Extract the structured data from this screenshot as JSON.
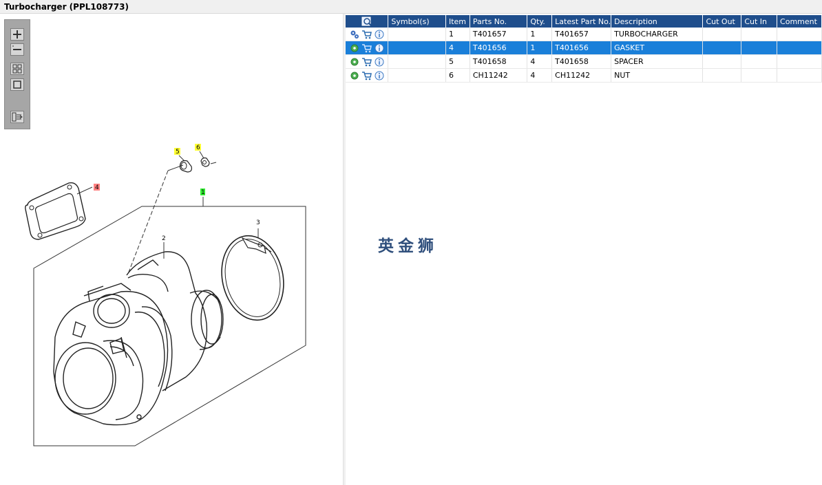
{
  "window": {
    "title": "Turbocharger (PPL108773)"
  },
  "toolbar": {
    "zoom_in": "zoom-in-icon",
    "zoom_out": "zoom-out-icon",
    "fit": "fit-icon",
    "actual": "actual-size-icon",
    "layout": "layout-icon"
  },
  "diagram": {
    "callouts": [
      {
        "label": "5",
        "highlight": "#ffff33"
      },
      {
        "label": "6",
        "highlight": "#ffff33"
      },
      {
        "label": "4",
        "highlight": "#ff8080"
      },
      {
        "label": "1",
        "highlight": "#33ee33"
      },
      {
        "label": "3",
        "highlight": ""
      },
      {
        "label": "2",
        "highlight": ""
      }
    ]
  },
  "table": {
    "columns": [
      "",
      "Symbol(s)",
      "Item",
      "Parts No.",
      "Qty.",
      "Latest Part No.",
      "Description",
      "Cut Out",
      "Cut In",
      "Comment"
    ],
    "rows": [
      {
        "symbols": "",
        "item": "1",
        "part_no": "T401657",
        "qty": "1",
        "latest": "T401657",
        "description": "TURBOCHARGER",
        "cut_out": "",
        "cut_in": "",
        "comment": ""
      },
      {
        "symbols": "",
        "item": "4",
        "part_no": "T401656",
        "qty": "1",
        "latest": "T401656",
        "description": "GASKET",
        "cut_out": "",
        "cut_in": "",
        "comment": ""
      },
      {
        "symbols": "",
        "item": "5",
        "part_no": "T401658",
        "qty": "4",
        "latest": "T401658",
        "description": "SPACER",
        "cut_out": "",
        "cut_in": "",
        "comment": ""
      },
      {
        "symbols": "",
        "item": "6",
        "part_no": "CH11242",
        "qty": "4",
        "latest": "CH11242",
        "description": "NUT",
        "cut_out": "",
        "cut_in": "",
        "comment": ""
      }
    ]
  },
  "watermark": "英金狮",
  "colors": {
    "header": "#1f4e8c",
    "selected": "#1a7fd9"
  }
}
